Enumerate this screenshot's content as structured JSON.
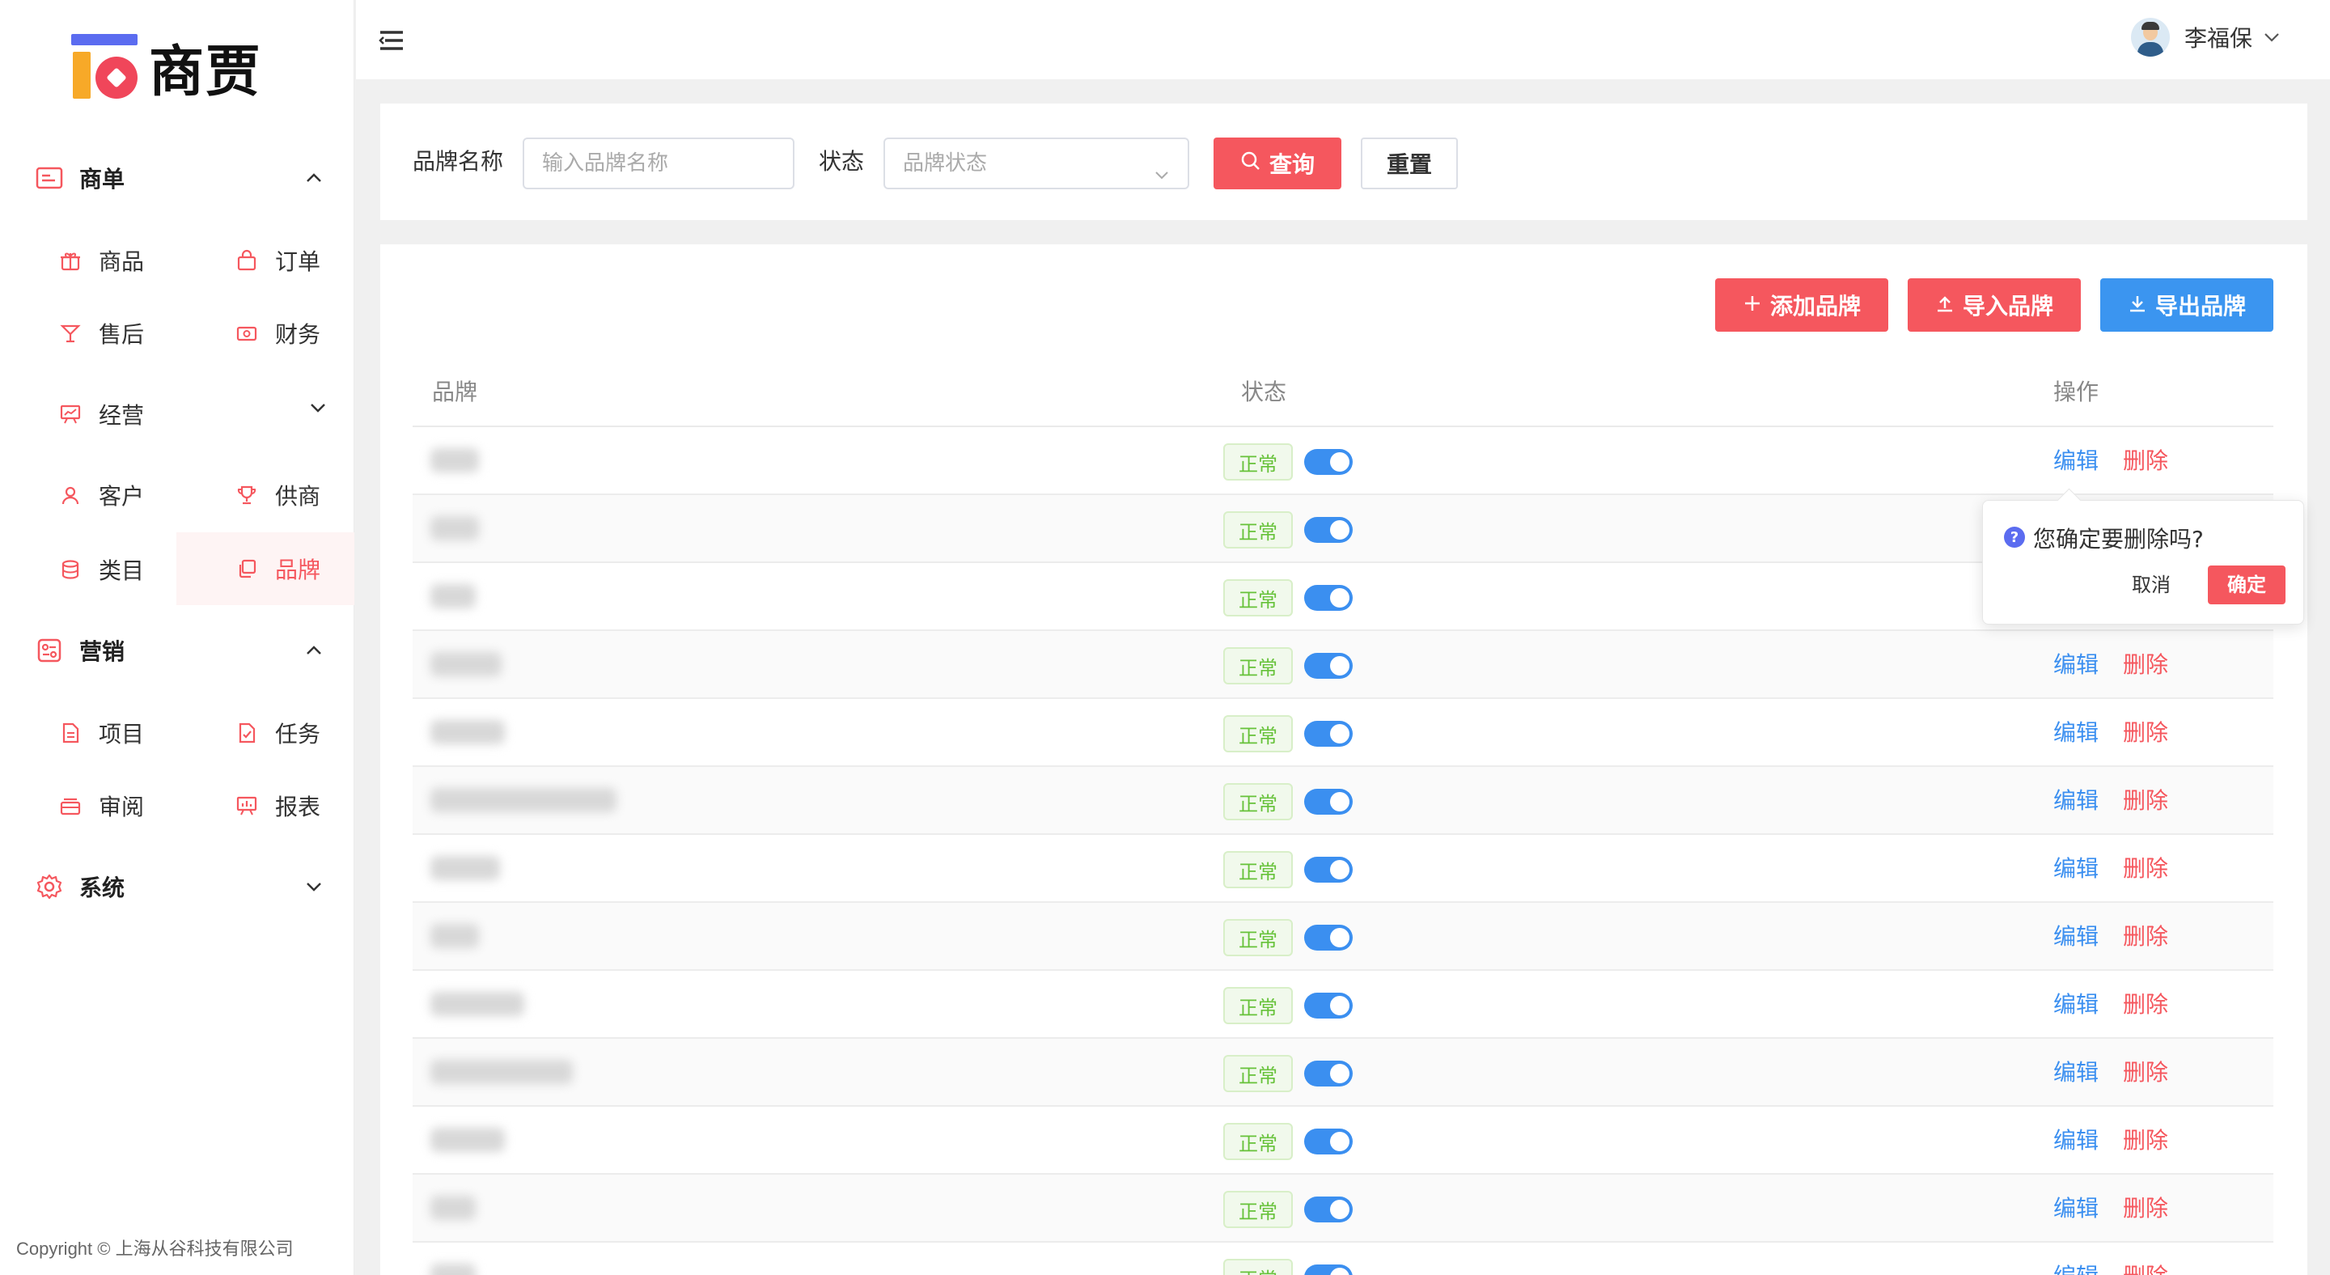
{
  "app": {
    "logo_text": "商贾"
  },
  "sidebar": {
    "groups": [
      {
        "label": "商单",
        "icon": "order-form-icon",
        "expanded": true
      },
      {
        "label": "营销",
        "icon": "marketing-icon",
        "expanded": true
      },
      {
        "label": "系统",
        "icon": "gear-icon",
        "expanded": false
      }
    ],
    "items": [
      {
        "label": "商品",
        "icon": "gift-box-icon"
      },
      {
        "label": "订单",
        "icon": "shopping-bag-icon"
      },
      {
        "label": "售后",
        "icon": "cocktail-icon"
      },
      {
        "label": "财务",
        "icon": "banknote-icon"
      },
      {
        "label": "经营",
        "icon": "presentation-chart-icon"
      },
      {
        "label": "客户",
        "icon": "user-icon"
      },
      {
        "label": "供商",
        "icon": "trophy-icon"
      },
      {
        "label": "类目",
        "icon": "database-icon"
      },
      {
        "label": "品牌",
        "icon": "copy-icon",
        "active": true
      },
      {
        "label": "项目",
        "icon": "document-icon"
      },
      {
        "label": "任务",
        "icon": "task-check-icon"
      },
      {
        "label": "审阅",
        "icon": "inbox-icon"
      },
      {
        "label": "报表",
        "icon": "report-board-icon"
      }
    ],
    "copyright": "Copyright © 上海从谷科技有限公司"
  },
  "header": {
    "user_name": "李福保"
  },
  "filter": {
    "brand_label": "品牌名称",
    "brand_placeholder": "输入品牌名称",
    "status_label": "状态",
    "status_placeholder": "品牌状态",
    "query_label": "查询",
    "reset_label": "重置"
  },
  "toolbar": {
    "add_label": "添加品牌",
    "import_label": "导入品牌",
    "export_label": "导出品牌"
  },
  "table": {
    "columns": [
      "品牌",
      "状态",
      "操作"
    ],
    "status_text": "正常",
    "edit_label": "编辑",
    "delete_label": "删除",
    "rows": [
      {
        "status": "正常",
        "enabled": true,
        "actions_visible": true
      },
      {
        "status": "正常",
        "enabled": true,
        "actions_visible": false
      },
      {
        "status": "正常",
        "enabled": true,
        "actions_visible": false
      },
      {
        "status": "正常",
        "enabled": true,
        "actions_visible": true
      },
      {
        "status": "正常",
        "enabled": true,
        "actions_visible": true
      },
      {
        "status": "正常",
        "enabled": true,
        "actions_visible": true
      },
      {
        "status": "正常",
        "enabled": true,
        "actions_visible": true
      },
      {
        "status": "正常",
        "enabled": true,
        "actions_visible": true
      },
      {
        "status": "正常",
        "enabled": true,
        "actions_visible": true
      },
      {
        "status": "正常",
        "enabled": true,
        "actions_visible": true
      },
      {
        "status": "正常",
        "enabled": true,
        "actions_visible": true
      },
      {
        "status": "正常",
        "enabled": true,
        "actions_visible": true
      },
      {
        "status": "正常",
        "enabled": true,
        "actions_visible": true
      }
    ]
  },
  "popconfirm": {
    "message": "您确定要删除吗?",
    "cancel_label": "取消",
    "confirm_label": "确定"
  },
  "colors": {
    "primary_red": "#f5575e",
    "primary_blue": "#3b8ff0",
    "success_green": "#67c23a"
  }
}
